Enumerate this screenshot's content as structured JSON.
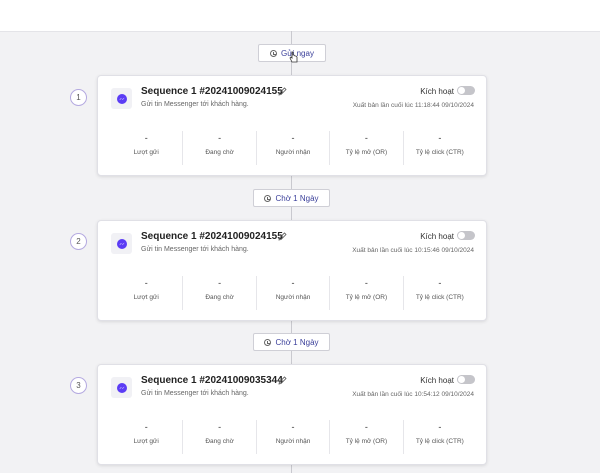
{
  "send_now_label": "Gửi ngay",
  "wait_labels": [
    "Chờ 1 Ngày",
    "Chờ 1 Ngày"
  ],
  "stat_labels": [
    "Lượt gửi",
    "Đang chờ",
    "Người nhận",
    "Tỷ lệ mở (OR)",
    "Tỷ lệ click (CTR)"
  ],
  "colors": {
    "accent": "#3a3f9a",
    "messenger": "#5b3cf5",
    "toggle_off": "#c5c5ca"
  },
  "steps": [
    {
      "number": "1",
      "title": "Sequence 1 #20241009024155",
      "description": "Gửi tin Messenger tới khách hàng.",
      "activate_label": "Kích hoạt",
      "activated": false,
      "published": "Xuất bản lần cuối lúc 11:18:44 09/10/2024",
      "stats": [
        "-",
        "-",
        "-",
        "-",
        "-"
      ]
    },
    {
      "number": "2",
      "title": "Sequence 1 #20241009024155",
      "description": "Gửi tin Messenger tới khách hàng.",
      "activate_label": "Kích hoạt",
      "activated": false,
      "published": "Xuất bản lần cuối lúc 10:15:46 09/10/2024",
      "stats": [
        "-",
        "-",
        "-",
        "-",
        "-"
      ]
    },
    {
      "number": "3",
      "title": "Sequence 1 #20241009035344",
      "description": "Gửi tin Messenger tới khách hàng.",
      "activate_label": "Kích hoạt",
      "activated": false,
      "published": "Xuất bản lần cuối lúc 10:54:12 09/10/2024",
      "stats": [
        "-",
        "-",
        "-",
        "-",
        "-"
      ]
    }
  ]
}
